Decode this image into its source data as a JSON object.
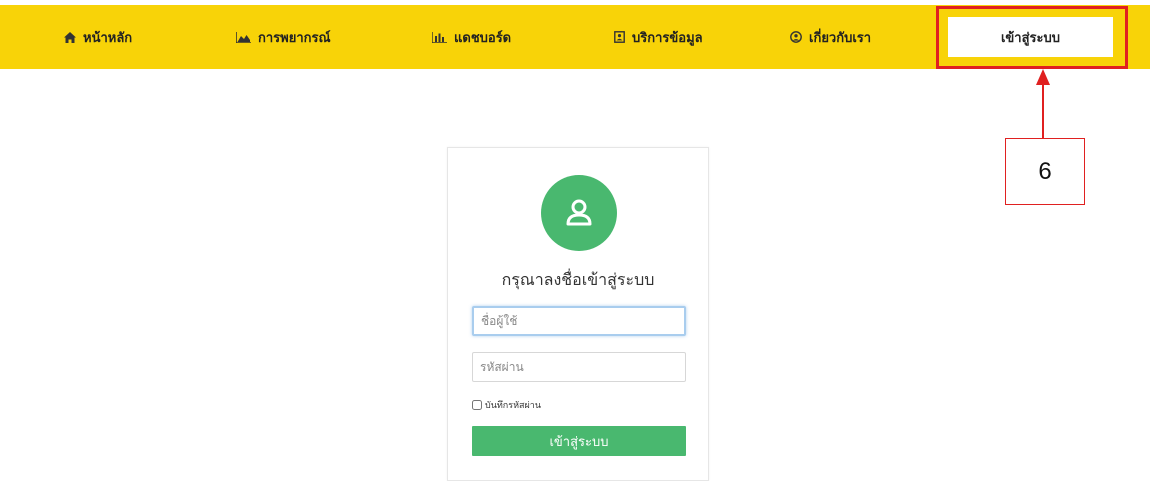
{
  "nav": {
    "items": [
      {
        "label": "หน้าหลัก",
        "icon": "home-icon"
      },
      {
        "label": "การพยากรณ์",
        "icon": "area-chart-icon"
      },
      {
        "label": "แดชบอร์ด",
        "icon": "bar-chart-icon"
      },
      {
        "label": "บริการข้อมูล",
        "icon": "contact-card-icon"
      },
      {
        "label": "เกี่ยวกับเรา",
        "icon": "user-circle-icon"
      }
    ],
    "login_label": "เข้าสู่ระบบ"
  },
  "annotation": {
    "number": "6",
    "color": "#e02020"
  },
  "login_card": {
    "avatar_icon": "user-icon",
    "title": "กรุณาลงชื่อเข้าสู่ระบบ",
    "username_placeholder": "ชื่อผู้ใช้",
    "password_placeholder": "รหัสผ่าน",
    "remember_label": "บันทึกรหัสผ่าน",
    "submit_label": "เข้าสู่ระบบ"
  },
  "colors": {
    "navbar": "#f8d308",
    "accent": "#49b86f"
  }
}
